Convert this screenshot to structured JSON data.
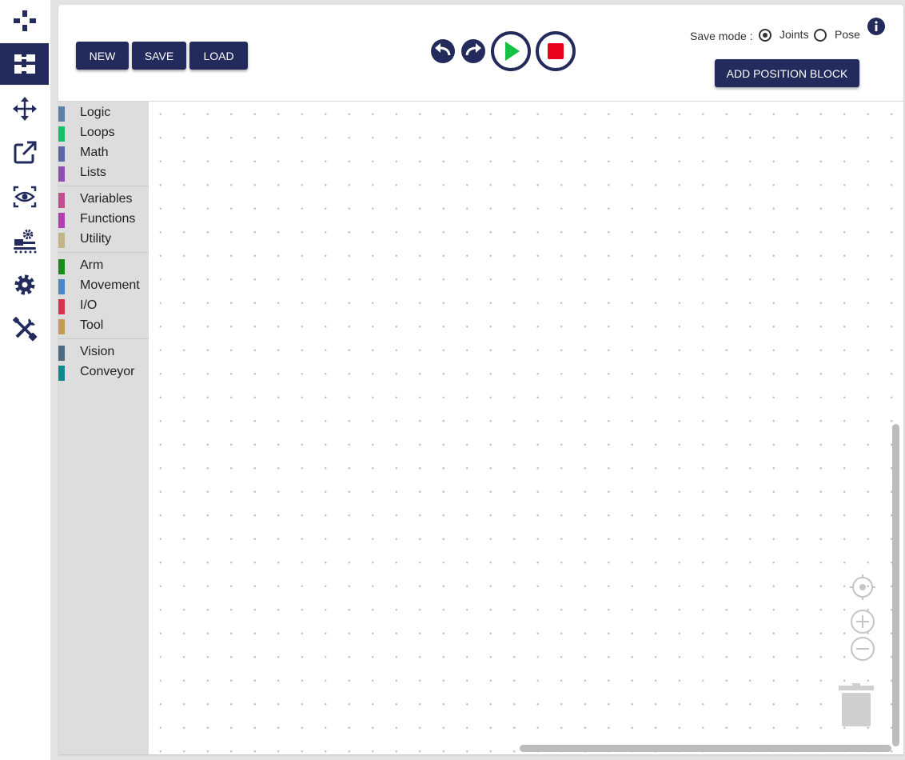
{
  "sidebar": {
    "items": [
      {
        "icon": "gamepad-icon",
        "active": false
      },
      {
        "icon": "blocks-puzzle-icon",
        "active": true
      },
      {
        "icon": "move-arrows-icon",
        "active": false
      },
      {
        "icon": "external-link-icon",
        "active": false
      },
      {
        "icon": "vision-eye-icon",
        "active": false
      },
      {
        "icon": "conveyor-gear-icon",
        "active": false
      },
      {
        "icon": "settings-gear-icon",
        "active": false
      },
      {
        "icon": "tools-icon",
        "active": false
      }
    ]
  },
  "toolbar": {
    "new_label": "NEW",
    "save_label": "SAVE",
    "load_label": "LOAD",
    "undo_icon": "undo-icon",
    "redo_icon": "redo-icon",
    "play_icon": "play-icon",
    "stop_icon": "stop-icon",
    "save_mode_label": "Save mode :",
    "save_mode_options": [
      {
        "label": "Joints",
        "checked": true
      },
      {
        "label": "Pose",
        "checked": false
      }
    ],
    "add_position_label": "ADD POSITION BLOCK",
    "info_icon": "info-icon"
  },
  "toolbox": {
    "groups": [
      [
        {
          "label": "Logic",
          "color": "#5b80a5"
        },
        {
          "label": "Loops",
          "color": "#13c06b"
        },
        {
          "label": "Math",
          "color": "#5b67a5"
        },
        {
          "label": "Lists",
          "color": "#8f4fb1"
        }
      ],
      [
        {
          "label": "Variables",
          "color": "#bf4f8f"
        },
        {
          "label": "Functions",
          "color": "#b13fb1"
        },
        {
          "label": "Utility",
          "color": "#c2b483"
        }
      ],
      [
        {
          "label": "Arm",
          "color": "#1a8a1a"
        },
        {
          "label": "Movement",
          "color": "#4a86c8"
        },
        {
          "label": "I/O",
          "color": "#d9304f"
        },
        {
          "label": "Tool",
          "color": "#c49a55"
        }
      ],
      [
        {
          "label": "Vision",
          "color": "#4d6b82"
        },
        {
          "label": "Conveyor",
          "color": "#12878f"
        }
      ]
    ]
  },
  "workspace": {
    "controls": [
      "recenter-icon",
      "zoom-in-icon",
      "zoom-out-icon",
      "trash-icon"
    ]
  },
  "colors": {
    "primary": "#232a5c",
    "play": "#14c243",
    "stop": "#e8001c"
  }
}
